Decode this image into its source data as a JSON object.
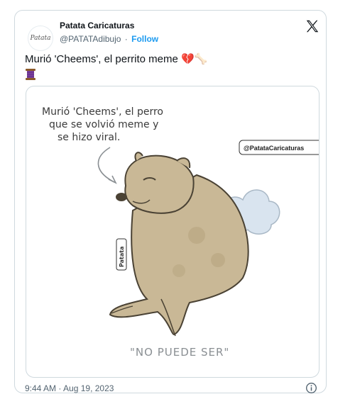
{
  "author": {
    "avatar_text": "Patata",
    "display_name": "Patata Caricaturas",
    "handle": "@PATATAdibujo",
    "separator": "·",
    "follow_label": "Follow"
  },
  "tweet": {
    "text": "Murió 'Cheems', el perrito meme 💔🦴",
    "emoji_line": "🧵"
  },
  "media": {
    "caption_lines": [
      "Murió 'Cheems', el perro",
      "que se volvió meme y",
      "se hizo viral."
    ],
    "tag": "@PatataCaricaturas",
    "signature": "Patata",
    "bottom_caption": "\"NO PUEDE SER\""
  },
  "footer": {
    "timestamp": "9:44 AM · Aug 19, 2023"
  },
  "icons": {
    "close": "x-logo-icon",
    "info": "info-icon"
  },
  "colors": {
    "accent": "#1d9bf0",
    "muted": "#536471",
    "border": "#cfd9de"
  }
}
